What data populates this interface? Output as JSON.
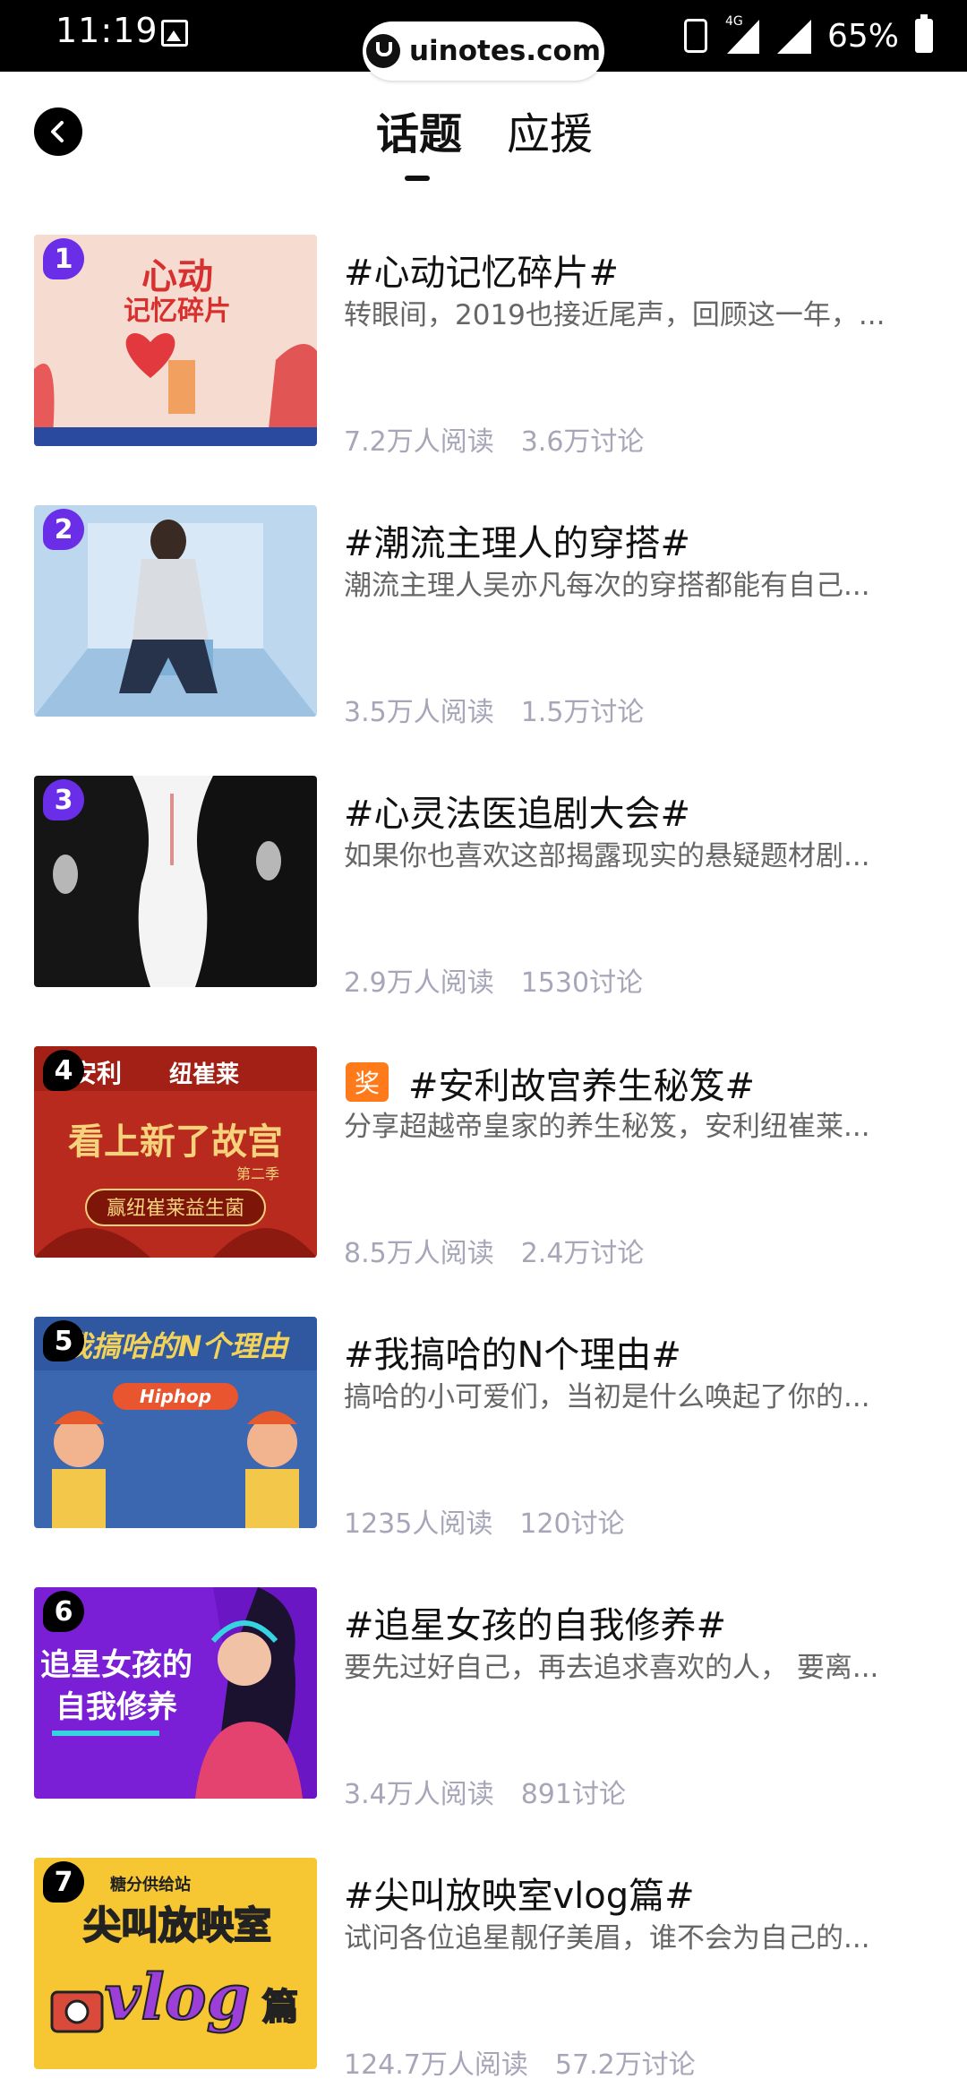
{
  "status_bar": {
    "time": "11:19",
    "battery_percent": "65%",
    "network": "4G"
  },
  "watermark": {
    "text": "uinotes.com"
  },
  "header": {
    "tabs": [
      {
        "label": "话题",
        "active": true
      },
      {
        "label": "应援",
        "active": false
      }
    ]
  },
  "colors": {
    "rank_top3": "#6b2ee8",
    "rank_other": "#000000",
    "award": "#ff7a1a",
    "stats": "#a6a6b8"
  },
  "topics": [
    {
      "rank": "1",
      "title": "#心动记忆碎片#",
      "desc": "转眼间，2019也接近尾声，回顾这一年，...",
      "reads": "7.2万人阅读",
      "discussions": "3.6万讨论",
      "award": ""
    },
    {
      "rank": "2",
      "title": "#潮流主理人的穿搭#",
      "desc": "潮流主理人吴亦凡每次的穿搭都能有自己...",
      "reads": "3.5万人阅读",
      "discussions": "1.5万讨论",
      "award": ""
    },
    {
      "rank": "3",
      "title": "#心灵法医追剧大会#",
      "desc": "如果你也喜欢这部揭露现实的悬疑题材剧...",
      "reads": "2.9万人阅读",
      "discussions": "1530讨论",
      "award": ""
    },
    {
      "rank": "4",
      "title": "#安利故宫养生秘笈#",
      "desc": "分享超越帝皇家的养生秘笈，安利纽崔莱...",
      "reads": "8.5万人阅读",
      "discussions": "2.4万讨论",
      "award": "奖"
    },
    {
      "rank": "5",
      "title": "#我搞哈的N个理由#",
      "desc": "搞哈的小可爱们，当初是什么唤起了你的...",
      "reads": "1235人阅读",
      "discussions": "120讨论",
      "award": ""
    },
    {
      "rank": "6",
      "title": "#追星女孩的自我修养#",
      "desc": "要先过好自己，再去追求喜欢的人， 要离...",
      "reads": "3.4万人阅读",
      "discussions": "891讨论",
      "award": ""
    },
    {
      "rank": "7",
      "title": "#尖叫放映室vlog篇#",
      "desc": "试问各位追星靓仔美眉，谁不会为自己的...",
      "reads": "124.7万人阅读",
      "discussions": "57.2万讨论",
      "award": ""
    }
  ],
  "thumb_text": {
    "t1_line1": "心动",
    "t1_line2": "记忆碎片",
    "t4_brand": "安利",
    "t4_brand2": "纽崔莱",
    "t4_main": "看上新了故宫",
    "t4_season": "第二季",
    "t4_banner": "赢纽崔莱益生菌",
    "t5_title": "我搞哈的N个理由",
    "t5_sub": "Hiphop",
    "t6_line1": "追星女孩的",
    "t6_line2": "自我修养",
    "t7_top": "糖分供给站",
    "t7_main": "尖叫放映室",
    "t7_vlog": "vlog",
    "t7_pian": "篇"
  }
}
